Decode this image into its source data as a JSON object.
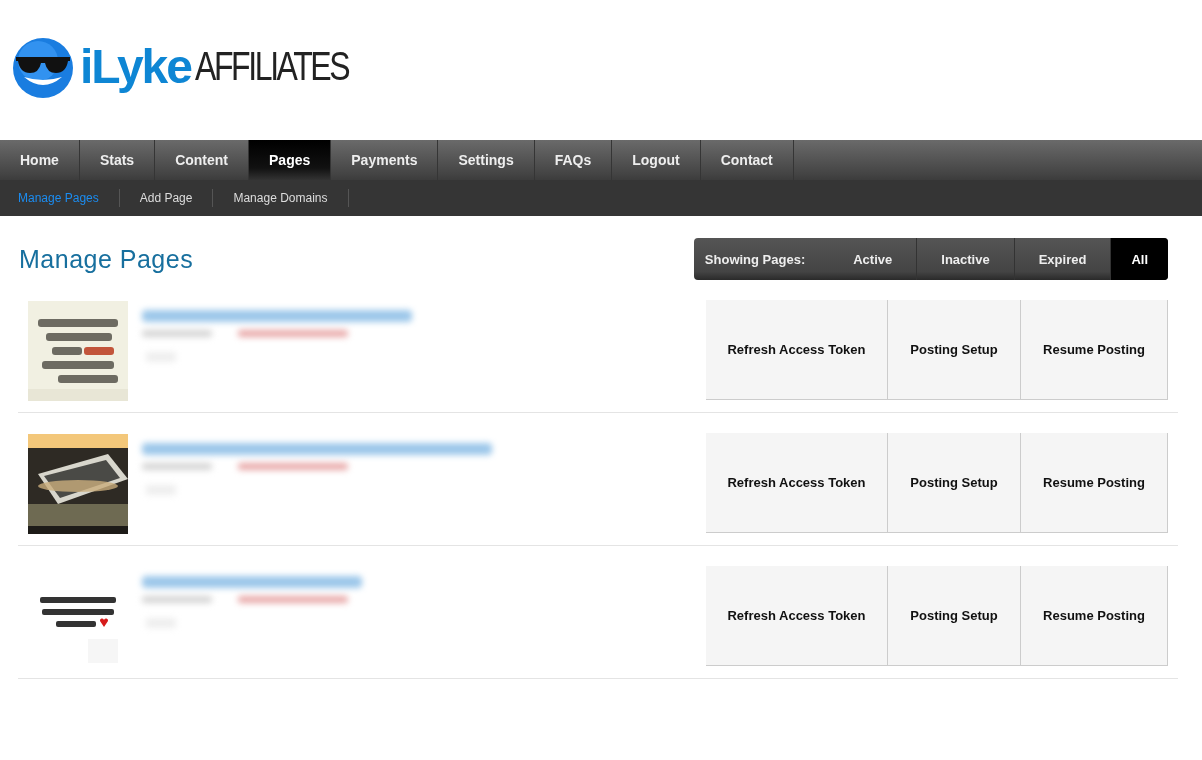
{
  "logo": {
    "brand": "iLyke",
    "suffix": "AFFILIATES"
  },
  "nav": [
    {
      "label": "Home",
      "selected": false
    },
    {
      "label": "Stats",
      "selected": false
    },
    {
      "label": "Content",
      "selected": false
    },
    {
      "label": "Pages",
      "selected": true
    },
    {
      "label": "Payments",
      "selected": false
    },
    {
      "label": "Settings",
      "selected": false
    },
    {
      "label": "FAQs",
      "selected": false
    },
    {
      "label": "Logout",
      "selected": false
    },
    {
      "label": "Contact",
      "selected": false
    }
  ],
  "subnav": [
    {
      "label": "Manage Pages",
      "selected": true
    },
    {
      "label": "Add Page",
      "selected": false
    },
    {
      "label": "Manage Domains",
      "selected": false
    }
  ],
  "heading": "Manage Pages",
  "filter": {
    "label": "Showing Pages:",
    "options": [
      {
        "label": "Active",
        "selected": false
      },
      {
        "label": "Inactive",
        "selected": false
      },
      {
        "label": "Expired",
        "selected": false
      },
      {
        "label": "All",
        "selected": true
      }
    ]
  },
  "pages": [
    {
      "thumbnail": {
        "kind": "picture"
      },
      "actions": [
        "Refresh Access Token",
        "Posting Setup",
        "Resume Posting"
      ]
    },
    {
      "thumbnail": {
        "kind": "picture"
      },
      "actions": [
        "Refresh Access Token",
        "Posting Setup",
        "Resume Posting"
      ]
    },
    {
      "thumbnail": {
        "kind": "picture"
      },
      "actions": [
        "Refresh Access Token",
        "Posting Setup",
        "Resume Posting"
      ]
    }
  ]
}
